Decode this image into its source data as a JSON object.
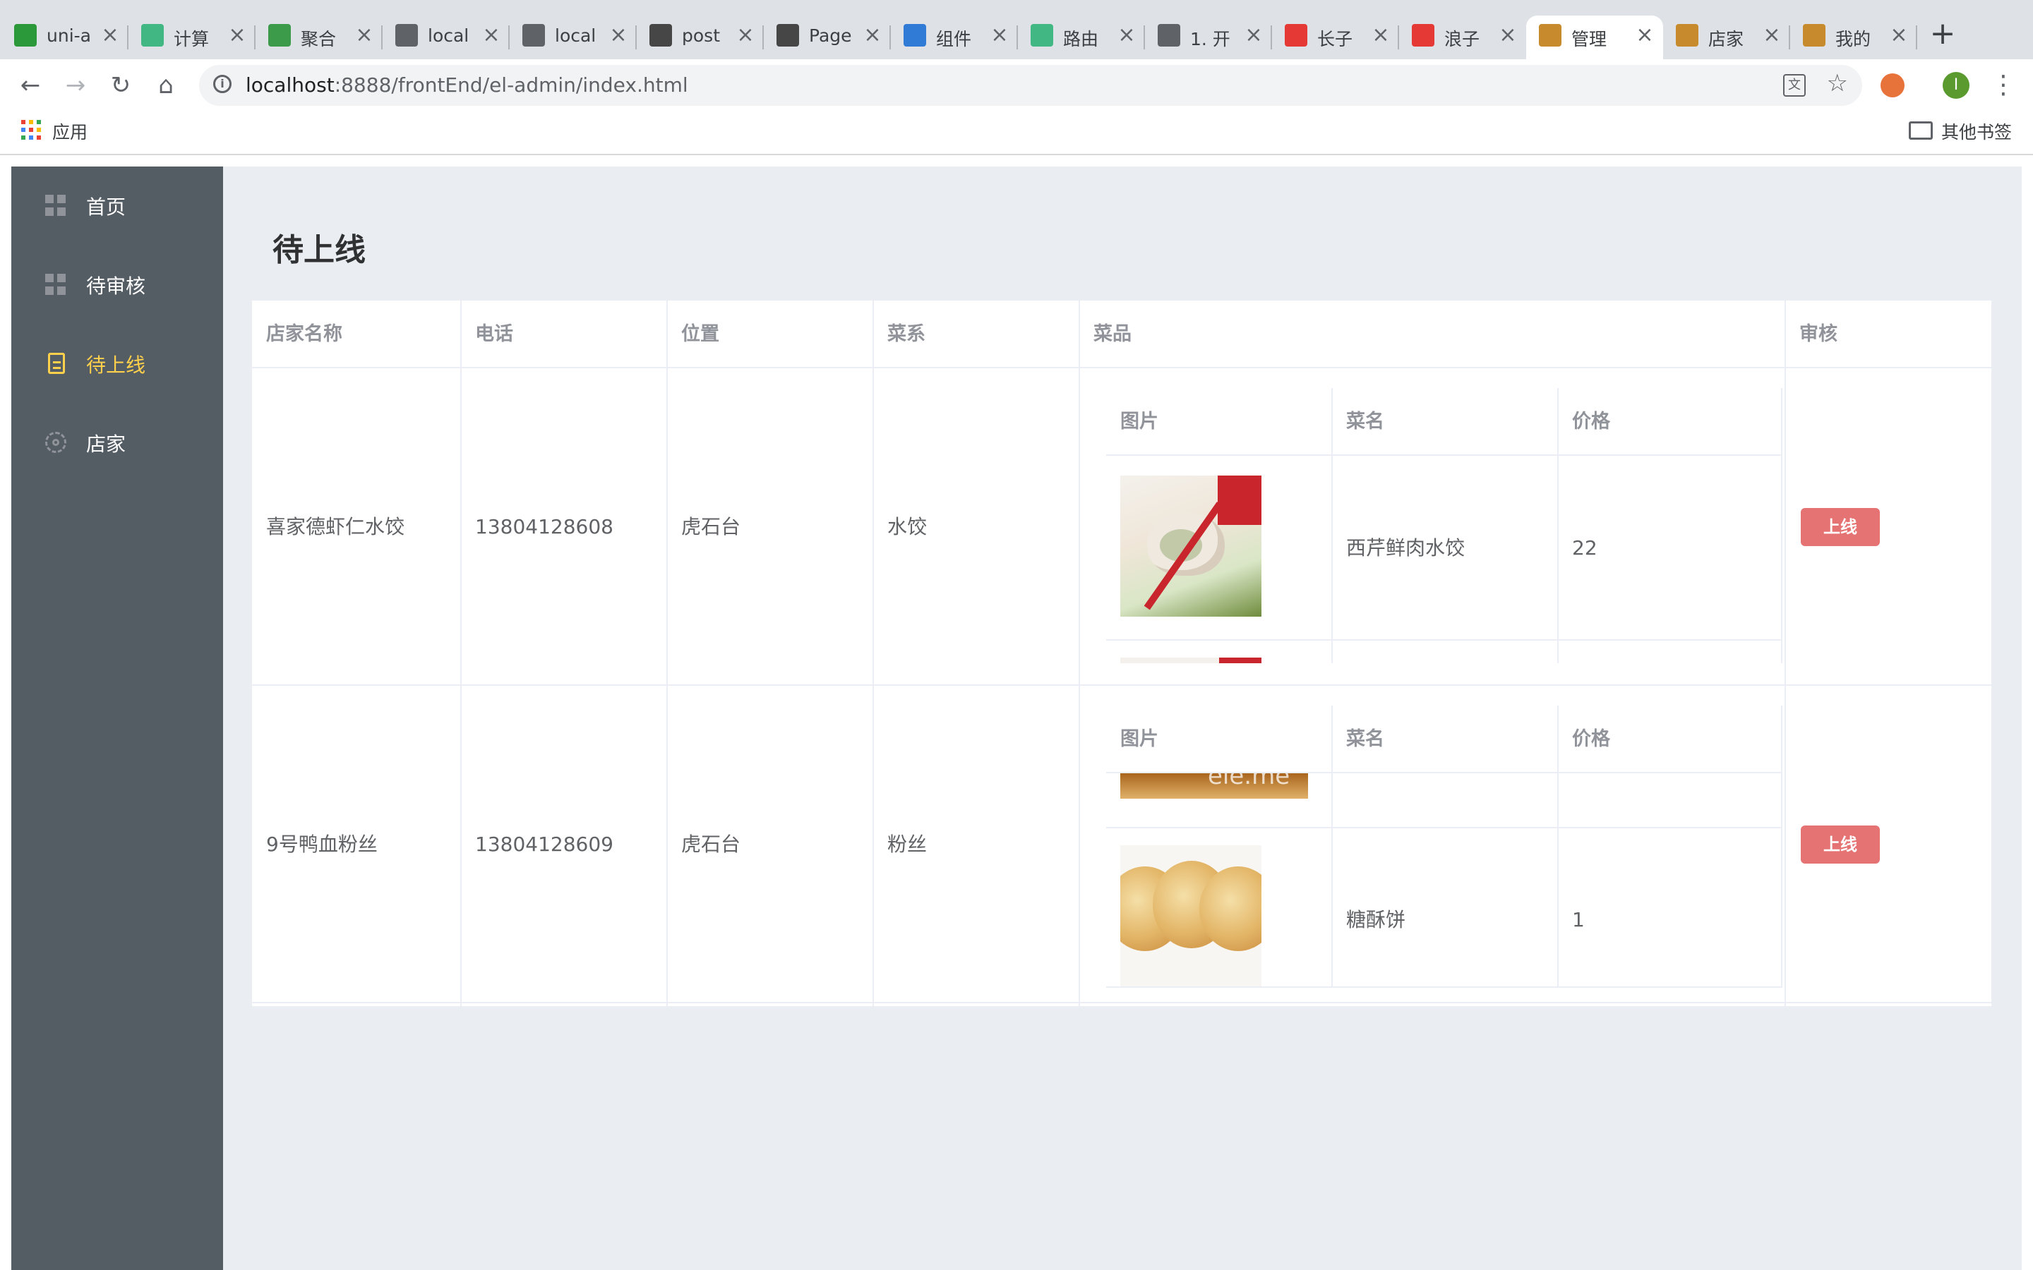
{
  "browser": {
    "tabs": [
      {
        "title": "uni-a",
        "icon": "uniapp-icon",
        "color": "#2b9939"
      },
      {
        "title": "计算",
        "icon": "vue-icon",
        "color": "#41b883"
      },
      {
        "title": "聚合",
        "icon": "cloud-icon",
        "color": "#3c9a4b"
      },
      {
        "title": "local",
        "icon": "page-icon",
        "color": "#5f6368"
      },
      {
        "title": "local",
        "icon": "github-icon",
        "color": "#5f6368"
      },
      {
        "title": "post",
        "icon": "wordpress-icon",
        "color": "#464646"
      },
      {
        "title": "Page",
        "icon": "wordpress-icon",
        "color": "#464646"
      },
      {
        "title": "组件",
        "icon": "cube-icon",
        "color": "#2f7bd6"
      },
      {
        "title": "路由",
        "icon": "vue-icon",
        "color": "#41b883"
      },
      {
        "title": "1. 开",
        "icon": "house-icon",
        "color": "#5f6368"
      },
      {
        "title": "长子",
        "icon": "video-icon",
        "color": "#e53935"
      },
      {
        "title": "浪子",
        "icon": "video-icon",
        "color": "#e53935"
      },
      {
        "title": "管理",
        "icon": "burger-icon",
        "color": "#c78a2c"
      },
      {
        "title": "店家",
        "icon": "burger-icon",
        "color": "#c78a2c"
      },
      {
        "title": "我的",
        "icon": "burger-icon",
        "color": "#c78a2c"
      }
    ],
    "active_tab": 12,
    "url_host": "localhost",
    "url_rest": ":8888/frontEnd/el-admin/index.html",
    "profile_initial": "I",
    "bookmarks_apps_label": "应用",
    "other_bookmarks_label": "其他书签"
  },
  "sidebar": {
    "items": [
      {
        "label": "首页",
        "icon": "grid-icon"
      },
      {
        "label": "待审核",
        "icon": "grid-icon"
      },
      {
        "label": "待上线",
        "icon": "document-icon",
        "active": true
      },
      {
        "label": "店家",
        "icon": "gear-icon"
      }
    ],
    "background": "#545c64",
    "active_color": "#ffd04b"
  },
  "page": {
    "title": "待上线"
  },
  "table": {
    "columns": [
      "店家名称",
      "电话",
      "位置",
      "菜系",
      "菜品",
      "审核"
    ],
    "dish_columns": [
      "图片",
      "菜名",
      "价格"
    ],
    "rows": [
      {
        "name": "喜家德虾仁水饺",
        "phone": "13804128608",
        "location": "虎石台",
        "cuisine": "水饺",
        "dishes": [
          {
            "image": "dumpling-image",
            "name": "西芹鲜肉水饺",
            "price": "22"
          }
        ],
        "action": "上线"
      },
      {
        "name": "9号鸭血粉丝",
        "phone": "13804128609",
        "location": "虎石台",
        "cuisine": "粉丝",
        "dishes": [
          {
            "image": "soup-image",
            "name": "",
            "price": "",
            "watermark": "ele.me"
          },
          {
            "image": "pastry-image",
            "name": "糖酥饼",
            "price": "1"
          }
        ],
        "action": "上线"
      }
    ],
    "button_color": "#e57373"
  }
}
